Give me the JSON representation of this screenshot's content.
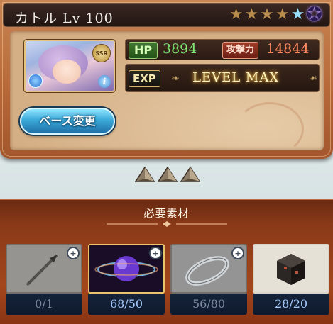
{
  "character": {
    "name": "カトル",
    "level_label": "Lv",
    "level": "100",
    "rarity": "SSR",
    "stars_total": 5,
    "stars_icons": [
      "bronze-star-icon",
      "bronze-star-icon",
      "bronze-star-icon",
      "bronze-star-icon",
      "blue-star-icon",
      "purple-star-icon"
    ]
  },
  "stats": {
    "hp_label": "HP",
    "hp_value": "3894",
    "atk_label": "攻撃力",
    "atk_value": "14844",
    "exp_label": "EXP",
    "exp_value": "LEVEL MAX"
  },
  "actions": {
    "base_change_label": "ベース変更"
  },
  "materials": {
    "header": "必要素材",
    "items": [
      {
        "name": "arrowhead-material",
        "count": "0/1",
        "state": "insufficient",
        "zoom": true
      },
      {
        "name": "purple-orb-material",
        "count": "68/50",
        "state": "sufficient",
        "zoom": true
      },
      {
        "name": "silver-ring-material",
        "count": "56/80",
        "state": "insufficient",
        "zoom": true
      },
      {
        "name": "dark-cube-material",
        "count": "28/20",
        "state": "sufficient",
        "zoom": false
      }
    ]
  },
  "colors": {
    "hp": "#7de76f",
    "atk": "#ff8a5e",
    "button": "#3aa9d8"
  }
}
